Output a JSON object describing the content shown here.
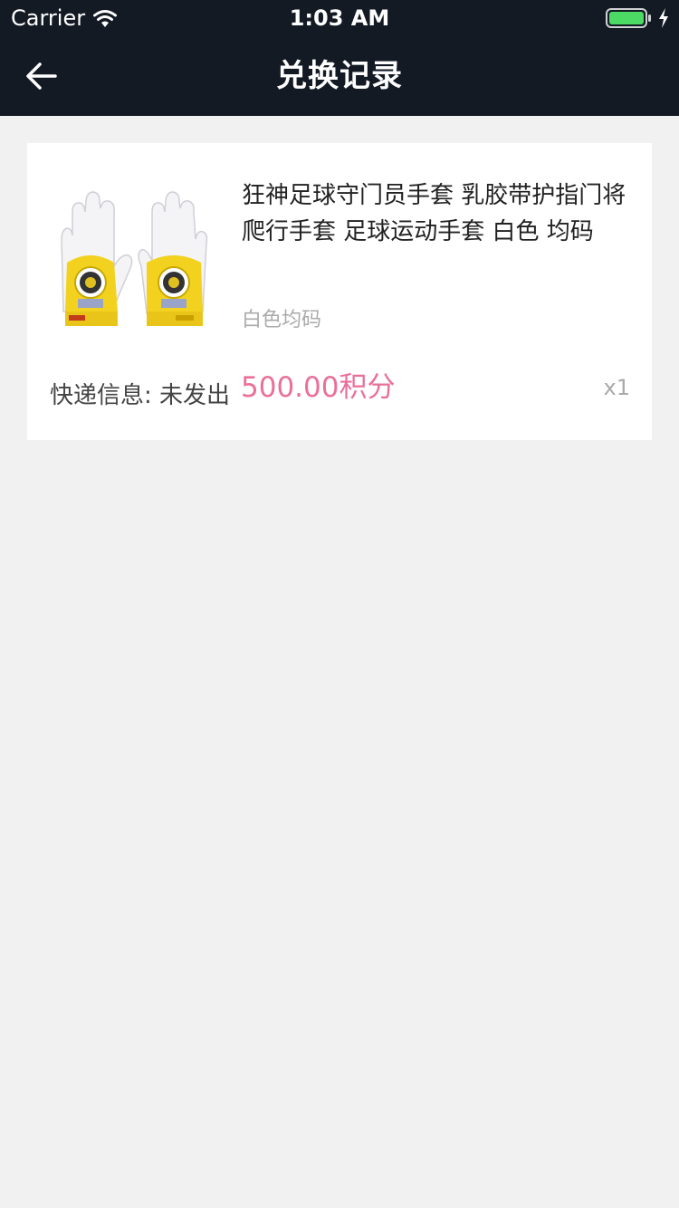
{
  "status_bar": {
    "carrier": "Carrier",
    "time": "1:03 AM",
    "battery_color": "#4cd964"
  },
  "nav": {
    "title": "兑换记录",
    "back_icon": "arrow-left-icon"
  },
  "record": {
    "product_title": "狂神足球守门员手套 乳胶带护指门将爬行手套 足球运动手套 白色 均码",
    "spec": "白色均码",
    "shipping_label": "快递信息:",
    "shipping_status": "未发出",
    "points": "500.00积分",
    "quantity": "x1",
    "image_icon": "goalkeeper-gloves-image"
  },
  "colors": {
    "header_bg": "#131a24",
    "page_bg": "#f1f1f1",
    "card_bg": "#ffffff",
    "accent": "#e9709b",
    "muted_text": "#aaaaaa"
  }
}
